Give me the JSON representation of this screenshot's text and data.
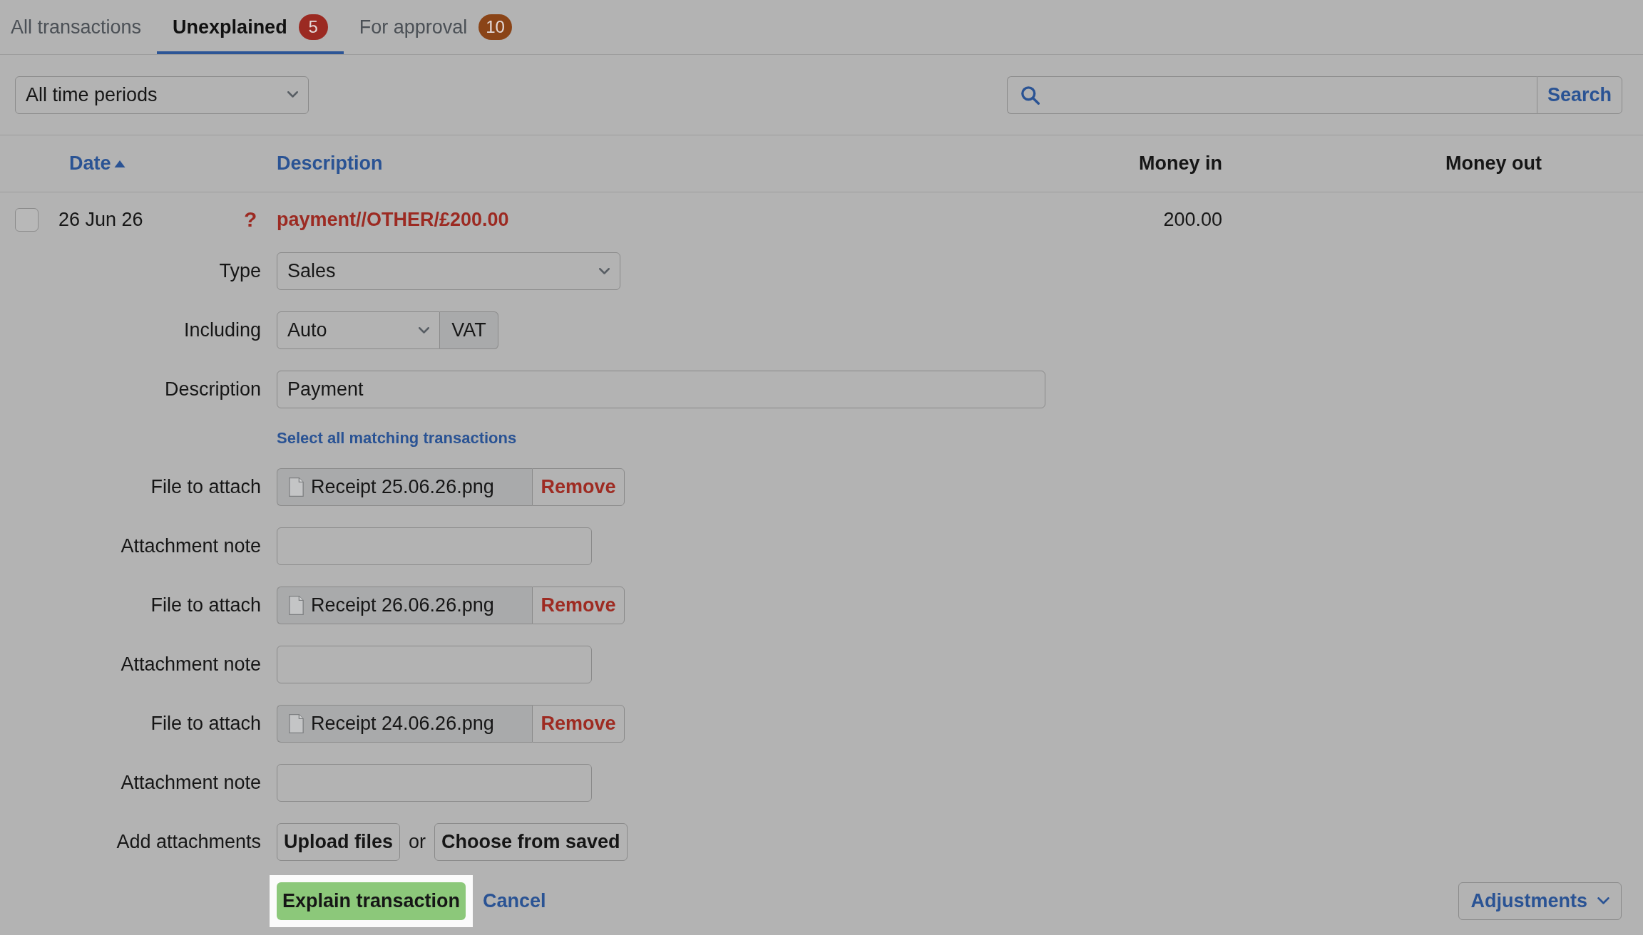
{
  "tabs": [
    {
      "label": "All transactions",
      "selected": false
    },
    {
      "label": "Unexplained",
      "selected": true,
      "badge": "5",
      "color": "#9b2a22"
    },
    {
      "label": "For approval",
      "selected": false,
      "badge": "10",
      "color": "#8a4417"
    }
  ],
  "filters": {
    "period": "All time periods",
    "search_button": "Search"
  },
  "table": {
    "columns": [
      {
        "label": "Date",
        "kind": "text",
        "sortable": true,
        "sorted": true
      },
      {
        "label": "Description",
        "kind": "text",
        "sortable": true,
        "sorted": false
      },
      {
        "label": "Money in",
        "kind": "amount",
        "sortable": false,
        "sorted": false
      },
      {
        "label": "Money out",
        "kind": "amount",
        "sortable": false,
        "sorted": false
      }
    ],
    "rows": [
      {
        "checked": false,
        "date": "26 Jun 26",
        "status": "?",
        "description": "payment//OTHER/£200.00",
        "money_in": "200.00"
      }
    ]
  },
  "form": {
    "fields": [
      {
        "kind": "select",
        "label": "Type",
        "value": "Sales"
      },
      {
        "kind": "select_addon",
        "label": "Including",
        "value": "Auto",
        "addon": "VAT"
      },
      {
        "kind": "text",
        "label": "Description",
        "value": "Payment"
      },
      {
        "kind": "link",
        "text": "Select all matching transactions"
      },
      {
        "kind": "file",
        "label": "File to attach",
        "file": "Receipt 25.06.26.png",
        "action": "Remove"
      },
      {
        "kind": "note",
        "label": "Attachment note"
      },
      {
        "kind": "file",
        "label": "File to attach",
        "file": "Receipt 26.06.26.png",
        "action": "Remove"
      },
      {
        "kind": "note",
        "label": "Attachment note"
      },
      {
        "kind": "file",
        "label": "File to attach",
        "file": "Receipt 24.06.26.png",
        "action": "Remove"
      },
      {
        "kind": "note",
        "label": "Attachment note"
      },
      {
        "kind": "attach",
        "label": "Add attachments",
        "buttons": [
          "Upload files",
          "Choose from saved"
        ],
        "separator": "or"
      }
    ]
  },
  "actions": {
    "primary": "Explain transaction",
    "highlighted": true,
    "cancel": "Cancel",
    "menu": "Adjustments"
  }
}
